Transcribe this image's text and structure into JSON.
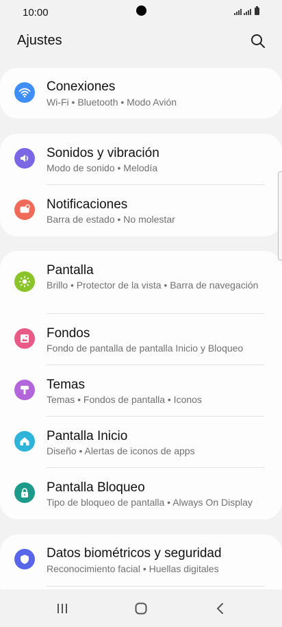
{
  "status": {
    "time": "10:00"
  },
  "header": {
    "title": "Ajustes",
    "search_icon": "search-icon"
  },
  "colors": {
    "background": "#f2f2f2",
    "card": "#fdfdfd",
    "conexiones": "#3f8ef5",
    "sonidos": "#7b67e6",
    "notificaciones": "#ef6a58",
    "pantalla": "#8bc32a",
    "fondos": "#e95b87",
    "temas": "#b266d9",
    "pantalla_inicio": "#2fb3d9",
    "pantalla_bloqueo": "#1e9a8a",
    "biometricos": "#5865e8"
  },
  "settings": [
    {
      "title": "Conexiones",
      "subtitle": "Wi-Fi  •  Bluetooth  •  Modo Avión",
      "icon": "wifi-icon"
    },
    {
      "title": "Sonidos y vibración",
      "subtitle": "Modo de sonido  •  Melodía",
      "icon": "sound-icon"
    },
    {
      "title": "Notificaciones",
      "subtitle": "Barra de estado  •  No molestar",
      "icon": "notification-icon"
    },
    {
      "title": "Pantalla",
      "subtitle": "Brillo  •  Protector de la vista  •  Barra de navegación",
      "icon": "brightness-icon"
    },
    {
      "title": "Fondos",
      "subtitle": "Fondo de pantalla de pantalla Inicio y Bloqueo",
      "icon": "wallpaper-icon"
    },
    {
      "title": "Temas",
      "subtitle": "Temas  •  Fondos de pantalla  •  Iconos",
      "icon": "themes-icon"
    },
    {
      "title": "Pantalla Inicio",
      "subtitle": "Diseño  •  Alertas de iconos de apps",
      "icon": "home-icon"
    },
    {
      "title": "Pantalla Bloqueo",
      "subtitle": "Tipo de bloqueo de pantalla  •  Always On Display",
      "icon": "lock-icon"
    },
    {
      "title": "Datos biométricos y seguridad",
      "subtitle": "Reconocimiento facial  •  Huellas digitales",
      "icon": "shield-icon"
    }
  ],
  "nav": {
    "recents_icon": "recents-icon",
    "home_icon": "home-button-icon",
    "back_icon": "back-icon"
  }
}
